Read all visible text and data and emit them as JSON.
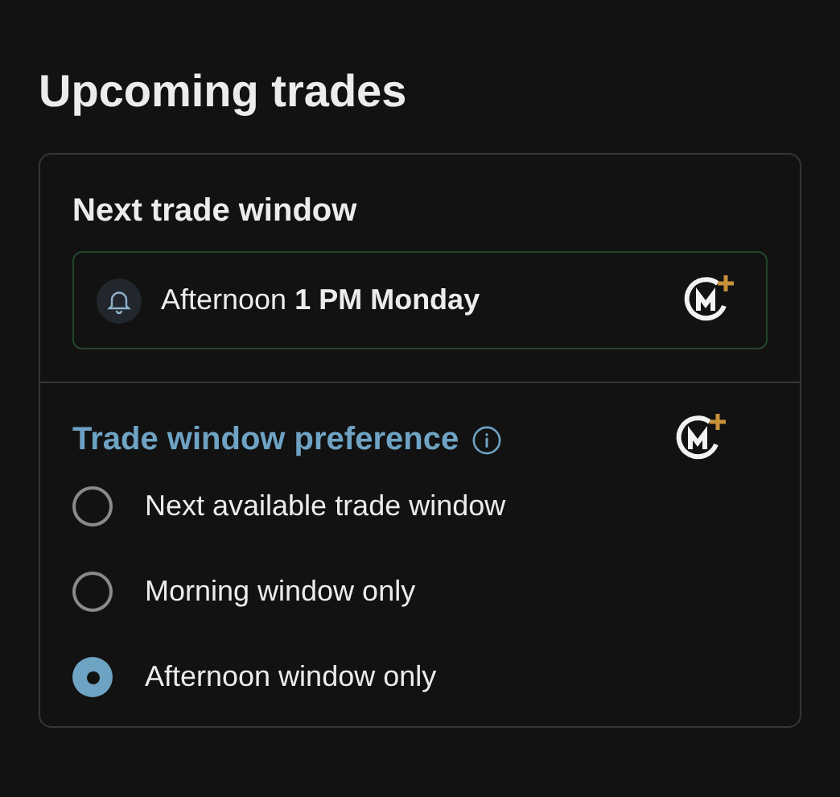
{
  "title": "Upcoming trades",
  "next_window": {
    "heading": "Next trade window",
    "text": "Afternoon **1 PM Monday**"
  },
  "preference": {
    "heading": "Trade window preference",
    "options": [
      {
        "label": "Next available trade window",
        "selected": false
      },
      {
        "label": "Morning window only",
        "selected": false
      },
      {
        "label": "Afternoon window only",
        "selected": true
      }
    ]
  }
}
